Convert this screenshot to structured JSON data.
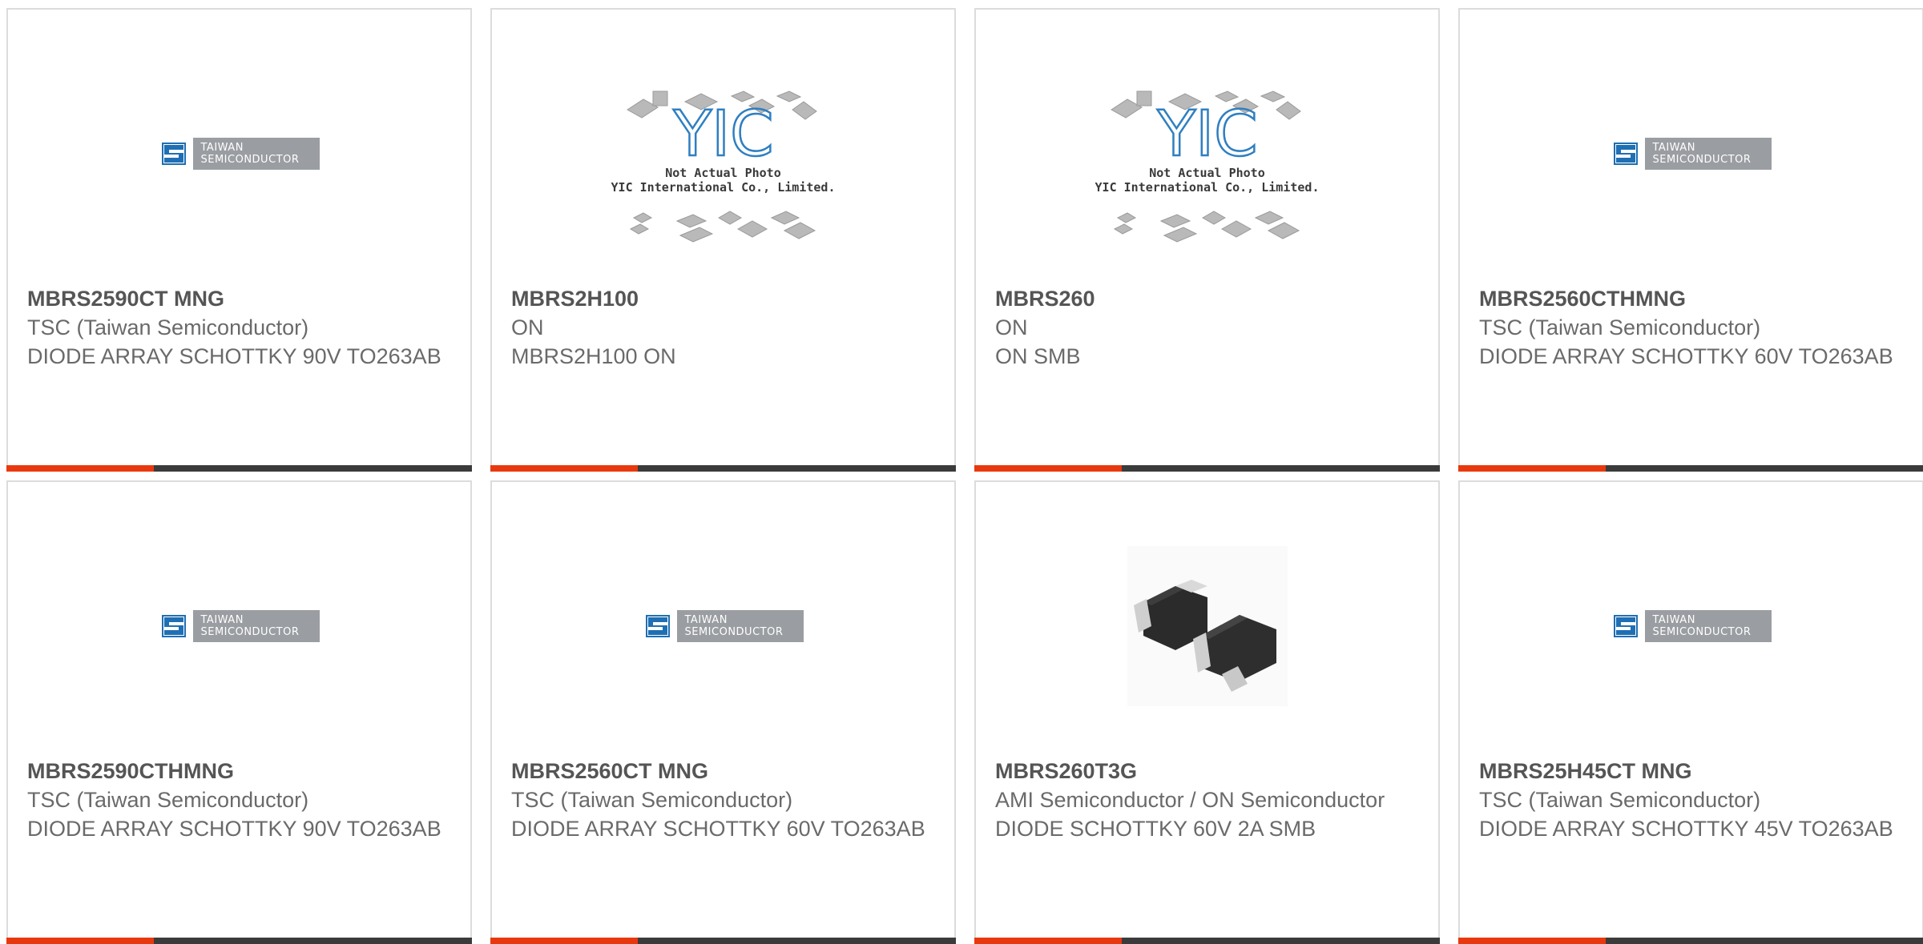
{
  "colors": {
    "accent": "#e8390e",
    "bar": "#3b3b3b",
    "card_border": "#dcdcdc",
    "text": "#6a6a6a"
  },
  "logos": {
    "tsc_line1": "TAIWAN",
    "tsc_line2": "SEMICONDUCTOR",
    "yic_mark": "YIC",
    "yic_caption1": "Not Actual Photo",
    "yic_caption2": "YIC International Co., Limited."
  },
  "products": [
    {
      "part": "MBRS2590CT MNG",
      "manufacturer": "TSC (Taiwan Semiconductor)",
      "description": "DIODE ARRAY SCHOTTKY 90V TO263AB",
      "image": "tsc-logo"
    },
    {
      "part": "MBRS2H100",
      "manufacturer": "ON",
      "description": "MBRS2H100 ON",
      "image": "yic-placeholder"
    },
    {
      "part": "MBRS260",
      "manufacturer": "ON",
      "description": "ON SMB",
      "image": "yic-placeholder"
    },
    {
      "part": "MBRS2560CTHMNG",
      "manufacturer": "TSC (Taiwan Semiconductor)",
      "description": "DIODE ARRAY SCHOTTKY 60V TO263AB",
      "image": "tsc-logo"
    },
    {
      "part": "MBRS2590CTHMNG",
      "manufacturer": "TSC (Taiwan Semiconductor)",
      "description": "DIODE ARRAY SCHOTTKY 90V TO263AB",
      "image": "tsc-logo"
    },
    {
      "part": "MBRS2560CT MNG",
      "manufacturer": "TSC (Taiwan Semiconductor)",
      "description": "DIODE ARRAY SCHOTTKY 60V TO263AB",
      "image": "tsc-logo"
    },
    {
      "part": "MBRS260T3G",
      "manufacturer": "AMI Semiconductor / ON Semiconductor",
      "description": "DIODE SCHOTTKY 60V 2A SMB",
      "image": "smb-diode-photo"
    },
    {
      "part": "MBRS25H45CT MNG",
      "manufacturer": "TSC (Taiwan Semiconductor)",
      "description": "DIODE ARRAY SCHOTTKY 45V TO263AB",
      "image": "tsc-logo"
    }
  ]
}
